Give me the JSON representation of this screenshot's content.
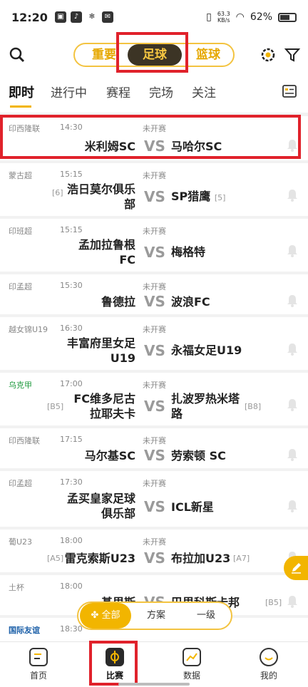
{
  "status": {
    "time": "12:20",
    "net_speed_top": "63.3",
    "net_speed_unit": "KB/s",
    "battery_percent": "62%"
  },
  "header": {
    "tabs": [
      {
        "label": "重要",
        "active": false
      },
      {
        "label": "足球",
        "active": true
      },
      {
        "label": "篮球",
        "active": false
      }
    ],
    "icons": [
      "search-icon",
      "gear-icon",
      "filter-icon"
    ]
  },
  "subtabs": [
    {
      "label": "即时",
      "active": true
    },
    {
      "label": "进行中",
      "active": false
    },
    {
      "label": "赛程",
      "active": false
    },
    {
      "label": "完场",
      "active": false
    },
    {
      "label": "关注",
      "active": false
    }
  ],
  "matches": [
    {
      "league": "印西隆联",
      "time": "14:30",
      "status": "未开赛",
      "home_lines": [
        "米利姆SC"
      ],
      "away_lines": [
        "马哈尔SC"
      ],
      "home_seed": "",
      "away_seed": "",
      "vs": "VS"
    },
    {
      "league": "蒙古超",
      "time": "15:15",
      "status": "未开赛",
      "home_lines": [
        "浩日莫尔俱乐",
        "部"
      ],
      "away_lines": [
        "SP猎鹰"
      ],
      "home_seed": "[6]",
      "away_seed": "[5]",
      "vs": "VS"
    },
    {
      "league": "印班超",
      "time": "15:15",
      "status": "未开赛",
      "home_lines": [
        "孟加拉鲁根",
        "FC"
      ],
      "away_lines": [
        "梅格特"
      ],
      "home_seed": "",
      "away_seed": "",
      "vs": "VS"
    },
    {
      "league": "印孟超",
      "time": "15:30",
      "status": "未开赛",
      "home_lines": [
        "鲁德拉"
      ],
      "away_lines": [
        "波浪FC"
      ],
      "home_seed": "",
      "away_seed": "",
      "vs": "VS"
    },
    {
      "league": "越女锦U19",
      "time": "16:30",
      "status": "未开赛",
      "home_lines": [
        "丰富府里女足",
        "U19"
      ],
      "away_lines": [
        "永福女足U19"
      ],
      "home_seed": "",
      "away_seed": "",
      "vs": "VS"
    },
    {
      "league": "乌克甲",
      "time": "17:00",
      "status": "未开赛",
      "home_lines": [
        "FC维多尼古",
        "拉耶夫卡"
      ],
      "away_lines": [
        "扎波罗热米塔",
        "路"
      ],
      "home_seed": "[B5]",
      "away_seed": "[B8]",
      "vs": "VS"
    },
    {
      "league": "印西隆联",
      "time": "17:15",
      "status": "未开赛",
      "home_lines": [
        "马尔基SC"
      ],
      "away_lines": [
        "劳索顿 SC"
      ],
      "home_seed": "",
      "away_seed": "",
      "vs": "VS"
    },
    {
      "league": "印孟超",
      "time": "17:30",
      "status": "未开赛",
      "home_lines": [
        "孟买皇家足球",
        "俱乐部"
      ],
      "away_lines": [
        "ICL新星"
      ],
      "home_seed": "",
      "away_seed": "",
      "vs": "VS"
    },
    {
      "league": "葡U23",
      "time": "18:00",
      "status": "未开赛",
      "home_lines": [
        "雷克索斯U23"
      ],
      "away_lines": [
        "布拉加U23"
      ],
      "home_seed": "[A5]",
      "away_seed": "[A7]",
      "vs": "VS"
    },
    {
      "league": "土杯",
      "time": "18:00",
      "status": "未开赛",
      "home_lines": [
        "基里斯"
      ],
      "away_lines": [
        "巴里科斯卡邦"
      ],
      "home_seed": "",
      "away_seed": "[B5]",
      "vs": "VS"
    },
    {
      "league": "国际友谊",
      "time": "18:30",
      "status": "未开赛",
      "home_lines": [
        ""
      ],
      "away_lines": [
        ""
      ],
      "home_seed": "",
      "away_seed": "",
      "vs": ""
    }
  ],
  "filter": [
    {
      "label": "全部",
      "active": true
    },
    {
      "label": "方案",
      "active": false
    },
    {
      "label": "一级",
      "active": false
    }
  ],
  "bottom_nav": [
    {
      "label": "首页",
      "icon": "home-doc-icon",
      "active": false
    },
    {
      "label": "比赛",
      "icon": "match-icon",
      "active": true
    },
    {
      "label": "数据",
      "icon": "chart-icon",
      "active": false
    },
    {
      "label": "我的",
      "icon": "profile-smile-icon",
      "active": false
    }
  ],
  "colors": {
    "accent": "#f2b500",
    "highlight": "#e0222b",
    "dark_pill": "#3c3425"
  }
}
